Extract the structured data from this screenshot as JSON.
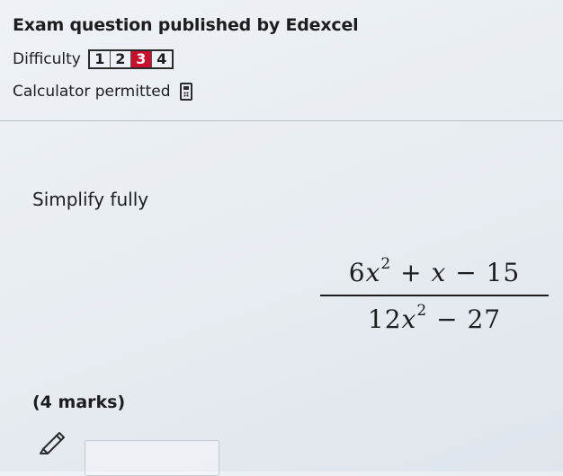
{
  "header": {
    "title": "Exam question published by Edexcel",
    "difficulty_label": "Difficulty",
    "difficulty_levels": [
      "1",
      "2",
      "3",
      "4"
    ],
    "difficulty_selected": "3",
    "calculator_label": "Calculator permitted",
    "calculator_icon": "calculator-icon"
  },
  "question": {
    "instruction": "Simplify fully",
    "fraction": {
      "numerator": {
        "coef1": "6",
        "var1": "x",
        "exp1": "2",
        "op1": " + ",
        "var2": "x",
        "op2": " − ",
        "const": "15"
      },
      "denominator": {
        "coef1": "12",
        "var1": "x",
        "exp1": "2",
        "op1": " − ",
        "const": "27"
      }
    },
    "marks": "(4 marks)"
  },
  "answer": {
    "icon": "pencil-icon",
    "value": ""
  },
  "colors": {
    "selected_level": "#c8102e",
    "text": "#1d1d1f",
    "background": "#e9eef3"
  }
}
